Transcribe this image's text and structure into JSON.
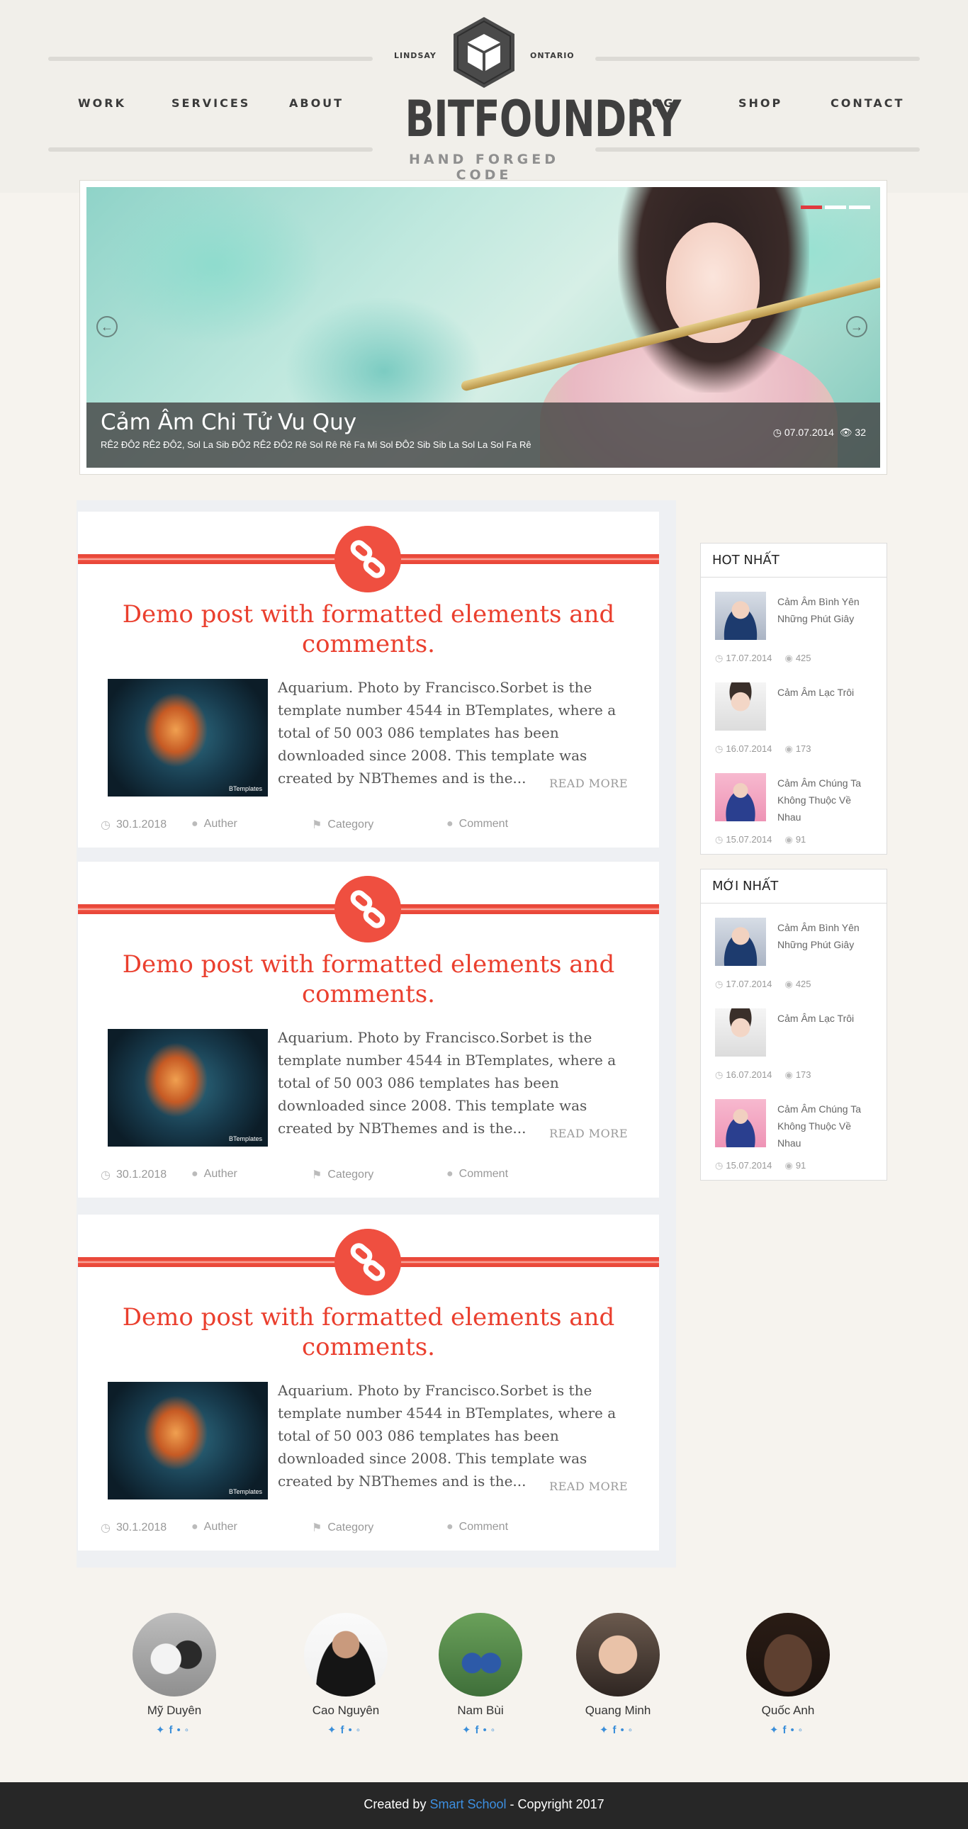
{
  "nav": {
    "left": [
      "WORK",
      "SERVICES",
      "ABOUT"
    ],
    "right": [
      "BLOG",
      "SHOP",
      "CONTACT"
    ]
  },
  "logo": {
    "left_small": "LINDSAY",
    "right_small": "ONTARIO",
    "name": "BITFOUNDRY",
    "tagline": "HAND FORGED CODE"
  },
  "slider": {
    "title": "Cảm Âm Chi Tử Vu Quy",
    "subtitle": "RÊ2 ĐÔ2 RÊ2 ĐÔ2, Sol La Sib ĐÔ2 RÊ2 ĐÔ2 Rê Sol Rê Rê Fa Mi Sol ĐÔ2 Sib Sib La Sol La Sol Fa Rê",
    "date": "07.07.2014",
    "views": "32",
    "prev_icon": "arrow-left-circle-icon",
    "next_icon": "arrow-right-circle-icon",
    "active_dot_color": "#e03a3e"
  },
  "posts": [
    {
      "title": "Demo post with formatted elements and comments.",
      "excerpt": "Aquarium. Photo by Francisco.Sorbet is the template number 4544 in BTemplates, where a total of 50 003 086 templates has been downloaded since 2008. This template was created by NBThemes and is the...",
      "read_more": "READ MORE",
      "date": "30.1.2018",
      "author": "Auther",
      "category": "Category",
      "comment": "Comment",
      "thumb_watermark": "BTemplates"
    },
    {
      "title": "Demo post with formatted elements and comments.",
      "excerpt": "Aquarium. Photo by Francisco.Sorbet is the template number 4544 in BTemplates, where a total of 50 003 086 templates has been downloaded since 2008. This template was created by NBThemes and is the...",
      "read_more": "READ MORE",
      "date": "30.1.2018",
      "author": "Auther",
      "category": "Category",
      "comment": "Comment",
      "thumb_watermark": "BTemplates"
    },
    {
      "title": "Demo post with formatted elements and comments.",
      "excerpt": "Aquarium. Photo by Francisco.Sorbet is the template number 4544 in BTemplates, where a total of 50 003 086 templates has been downloaded since 2008. This template was created by NBThemes and is the...",
      "read_more": "READ MORE",
      "date": "30.1.2018",
      "author": "Auther",
      "category": "Category",
      "comment": "Comment",
      "thumb_watermark": "BTemplates"
    }
  ],
  "accent_color": "#ea3f2e",
  "widgets": [
    {
      "title": "HOT NHẤT",
      "items": [
        {
          "title": "Cảm Âm Bình Yên Những Phút Giây",
          "date": "17.07.2014",
          "views": "425"
        },
        {
          "title": "Cảm Âm Lạc Trôi",
          "date": "16.07.2014",
          "views": "173"
        },
        {
          "title": "Cảm Âm Chúng Ta Không Thuộc Về Nhau",
          "date": "15.07.2014",
          "views": "91"
        }
      ]
    },
    {
      "title": "MỚI NHẤT",
      "items": [
        {
          "title": "Cảm Âm Bình Yên Những Phút Giây",
          "date": "17.07.2014",
          "views": "425"
        },
        {
          "title": "Cảm Âm Lạc Trôi",
          "date": "16.07.2014",
          "views": "173"
        },
        {
          "title": "Cảm Âm Chúng Ta Không Thuộc Về Nhau",
          "date": "15.07.2014",
          "views": "91"
        }
      ]
    }
  ],
  "team": [
    {
      "name": "Mỹ Duyên"
    },
    {
      "name": "Cao Nguyên"
    },
    {
      "name": "Nam Bùi"
    },
    {
      "name": "Quang Minh"
    },
    {
      "name": "Quốc Anh"
    }
  ],
  "footer": {
    "prefix": "Created by",
    "link": "Smart School",
    "suffix": "- Copyright 2017",
    "link_color": "#3d8fe0"
  }
}
